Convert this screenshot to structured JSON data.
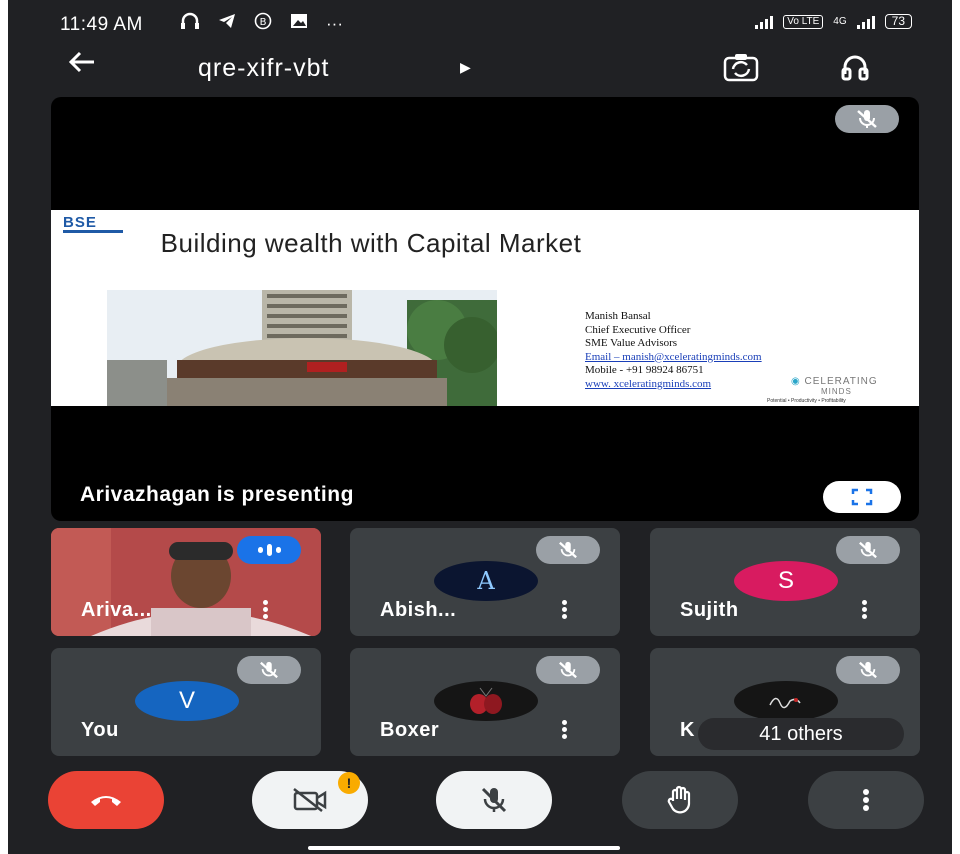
{
  "status_bar": {
    "time": "11:49 AM",
    "more": "···",
    "volte": "Vo LTE",
    "net": "4G",
    "battery": "73"
  },
  "app_bar": {
    "meeting_code": "qre-xifr-vbt"
  },
  "presentation": {
    "slide": {
      "logo": "BSE",
      "title": "Building wealth with Capital Market",
      "contact_lines": [
        "Manish Bansal",
        "Chief Executive Officer",
        "SME Value Advisors",
        "Email – manish@xceleratingminds.com",
        "Mobile - +91 98924 86751",
        "www. xceleratingminds.com"
      ],
      "brand": "CELERATING",
      "brand_sub": "MINDS",
      "tagline": "Potential • Productivity • Profitability"
    },
    "presenting_label": "Arivazhagan is presenting"
  },
  "participants": [
    {
      "name": "Ariva...",
      "initial": ""
    },
    {
      "name": "Abish...",
      "initial": "A"
    },
    {
      "name": "Sujith",
      "initial": "S"
    },
    {
      "name": "You",
      "initial": "V"
    },
    {
      "name": "Boxer",
      "initial": ""
    },
    {
      "name": "K",
      "initial": ""
    }
  ],
  "others_label": "41 others",
  "colors": {
    "background": "#202124",
    "tile": "#3c4043",
    "end_call": "#ea4335",
    "speaking": "#1a73e8",
    "sujith_avatar": "#d81b60",
    "you_avatar": "#1565c0",
    "warning_badge": "#f9ab00"
  },
  "controls": {
    "warning_badge": "!"
  }
}
